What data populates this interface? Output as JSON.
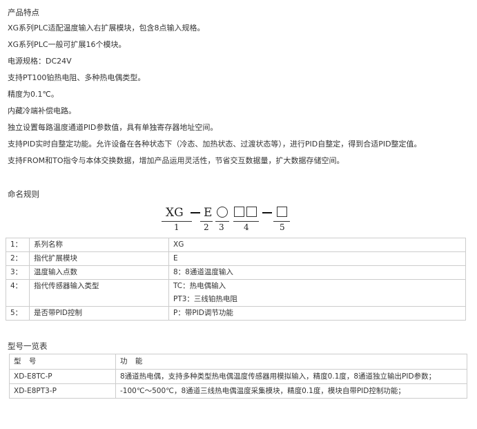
{
  "features": {
    "title": "产品特点",
    "items": [
      "XG系列PLC适配温度输入右扩展模块，包含8点输入规格。",
      "XG系列PLC一般可扩展16个模块。",
      "电源规格：DC24V",
      "支持PT100铂热电阻、多种热电偶类型。",
      "精度为0.1℃。",
      "内藏冷端补偿电路。",
      "独立设置每路温度通道PID参数值，具有单独寄存器地址空间。",
      "支持PID实时自整定功能。允许设备在各种状态下（冷态、加热状态、过渡状态等），进行PID自整定，得到合适PID整定值。",
      "支持FROM和TO指令与本体交换数据，增加产品运用灵活性，节省交互数据量，扩大数据存储空间。"
    ]
  },
  "naming": {
    "title": "命名规则",
    "prefix": "XG",
    "letter": "E",
    "numbers": [
      "1",
      "2",
      "3",
      "4",
      "5"
    ]
  },
  "naming_table": {
    "rows": [
      {
        "idx": "1：",
        "name": "系列名称",
        "value": [
          "XG"
        ]
      },
      {
        "idx": "2：",
        "name": "指代扩展模块",
        "value": [
          "E"
        ]
      },
      {
        "idx": "3：",
        "name": "温度输入点数",
        "value": [
          "8：8通道温度输入"
        ]
      },
      {
        "idx": "4：",
        "name": "指代传感器输入类型",
        "value": [
          "TC：热电偶输入",
          "PT3：三线铂热电阻"
        ]
      },
      {
        "idx": "5：",
        "name": "是否带PID控制",
        "value": [
          "P：带PID调节功能"
        ]
      }
    ]
  },
  "models": {
    "title": "型号一览表",
    "header": {
      "model": "型 号",
      "function": "功 能"
    },
    "rows": [
      {
        "model": "XD-E8TC-P",
        "function": "8通道热电偶，支持多种类型热电偶温度传感器用模拟输入，精度0.1度，8通道独立输出PID参数；"
      },
      {
        "model": "XD-E8PT3-P",
        "function": "-100℃～500℃，8通道三线热电偶温度采集模块，精度0.1度，模块自带PID控制功能；"
      }
    ]
  }
}
